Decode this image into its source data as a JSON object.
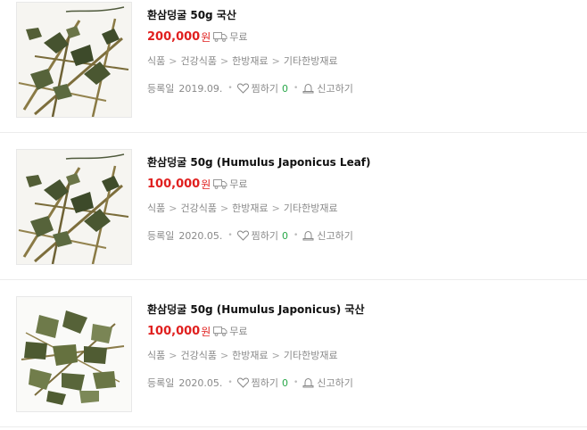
{
  "products": [
    {
      "title": "환삼덩굴 50g 국산",
      "price": "200,000",
      "currency": "원",
      "shipping": "무료",
      "category": [
        "식품",
        "건강식품",
        "한방재료",
        "기타한방재료"
      ],
      "reg_label": "등록일",
      "reg_date": "2019.09.",
      "zzim_label": "찜하기",
      "zzim_count": "0",
      "report_label": "신고하기"
    },
    {
      "title": "환삼덩굴 50g (Humulus Japonicus Leaf)",
      "price": "100,000",
      "currency": "원",
      "shipping": "무료",
      "category": [
        "식품",
        "건강식품",
        "한방재료",
        "기타한방재료"
      ],
      "reg_label": "등록일",
      "reg_date": "2020.05.",
      "zzim_label": "찜하기",
      "zzim_count": "0",
      "report_label": "신고하기"
    },
    {
      "title": "환삼덩굴 50g (Humulus Japonicus) 국산",
      "price": "100,000",
      "currency": "원",
      "shipping": "무료",
      "category": [
        "식품",
        "건강식품",
        "한방재료",
        "기타한방재료"
      ],
      "reg_label": "등록일",
      "reg_date": "2020.05.",
      "zzim_label": "찜하기",
      "zzim_count": "0",
      "report_label": "신고하기"
    }
  ],
  "colors": {
    "price": "#e0201f",
    "count": "#2aa84a",
    "muted": "#8a8a8a"
  },
  "icons": {
    "shipping": "truck-icon",
    "zzim": "heart-icon",
    "report": "bell-icon"
  }
}
